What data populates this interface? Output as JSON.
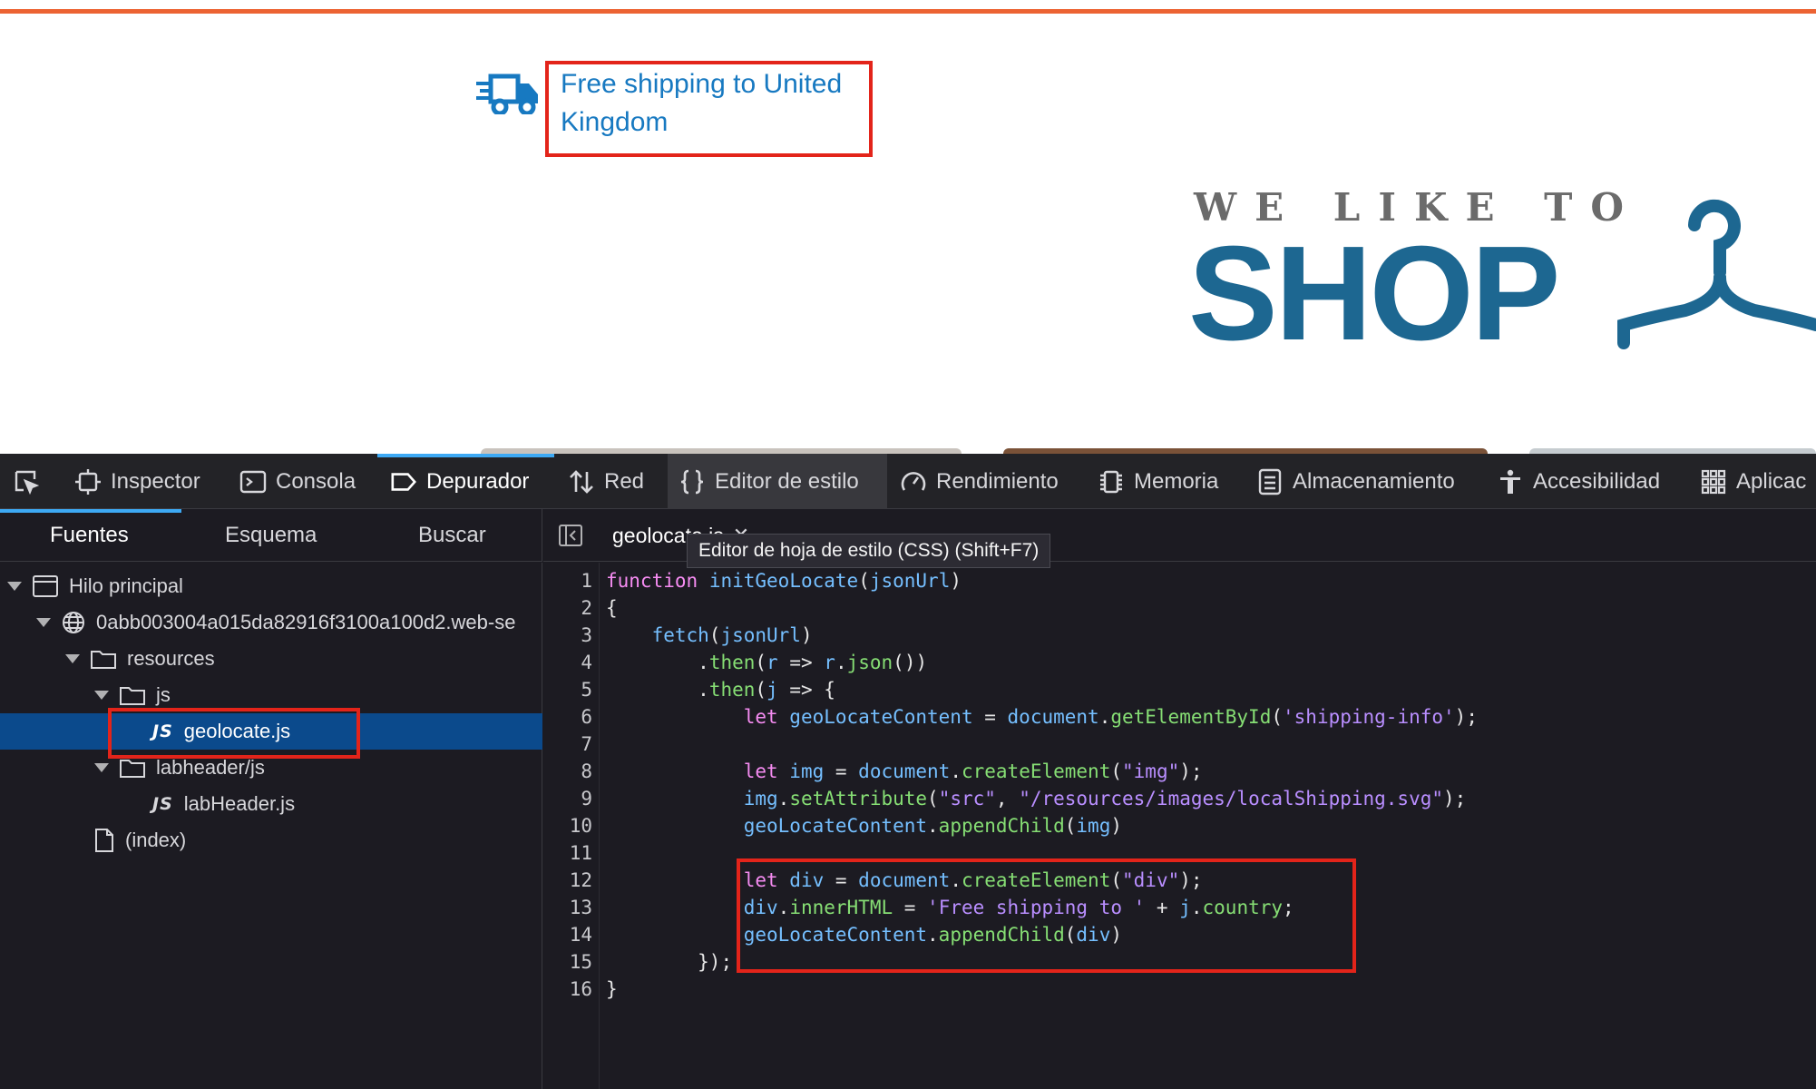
{
  "webpage": {
    "shipping_text": "Free shipping to United Kingdom",
    "tagline": "WE LIKE TO",
    "logo_word": "SHOP",
    "truck_icon": "truck-icon",
    "hanger_icon": "hanger-icon",
    "colors": {
      "accent_bar": "#ec6333",
      "link_blue": "#1779c1",
      "logo_blue": "#1d6791",
      "highlight_red": "#e3241a"
    }
  },
  "devtools": {
    "toolbar": {
      "picker_icon": "element-picker-icon",
      "tabs": [
        {
          "label": "Inspector",
          "icon": "inspector-icon"
        },
        {
          "label": "Consola",
          "icon": "console-icon"
        },
        {
          "label": "Depurador",
          "icon": "debugger-icon",
          "active": true
        },
        {
          "label": "Red",
          "icon": "network-icon"
        },
        {
          "label": "Editor de estilo",
          "icon": "style-editor-icon",
          "hovered": true
        },
        {
          "label": "Rendimiento",
          "icon": "performance-icon"
        },
        {
          "label": "Memoria",
          "icon": "memory-icon"
        },
        {
          "label": "Almacenamiento",
          "icon": "storage-icon"
        },
        {
          "label": "Accesibilidad",
          "icon": "accessibility-icon"
        },
        {
          "label": "Aplicac",
          "icon": "application-icon"
        }
      ]
    },
    "sources_tabs": [
      "Fuentes",
      "Esquema",
      "Buscar"
    ],
    "tree": {
      "main_thread": "Hilo principal",
      "domain": "0abb003004a015da82916f3100a100d2.web-se",
      "resources": "resources",
      "js_folder": "js",
      "geolocate_file": "geolocate.js",
      "labheader_folder": "labheader/js",
      "labheader_file": "labHeader.js",
      "index_file": "(index)",
      "js_badge": "JS"
    },
    "editor": {
      "tab_label": "geolocate.js",
      "tooltip": "Editor de hoja de estilo (CSS) (Shift+F7)",
      "line_numbers": [
        "1",
        "2",
        "3",
        "4",
        "5",
        "6",
        "7",
        "8",
        "9",
        "10",
        "11",
        "12",
        "13",
        "14",
        "15",
        "16"
      ],
      "code": {
        "l1": {
          "kw": "function",
          "name": "initGeoLocate",
          "p1": "(",
          "arg": "jsonUrl",
          "p2": ")"
        },
        "l2": "{",
        "l3": {
          "indent": "    ",
          "call": "fetch",
          "p1": "(",
          "arg": "jsonUrl",
          "p2": ")"
        },
        "l4": {
          "indent": "        ",
          "dot": ".",
          "then": "then",
          "p1": "(",
          "a": "r",
          "arrow": " => ",
          "b": "r",
          "dot2": ".",
          "json": "json",
          "end": "())"
        },
        "l5": {
          "indent": "        ",
          "dot": ".",
          "then": "then",
          "p1": "(",
          "a": "j",
          "arrow": " => ",
          "end": "{"
        },
        "l6": {
          "indent": "            ",
          "kw": "let",
          "name": " geoLocateContent",
          "eq": " = ",
          "obj": "document",
          "dot": ".",
          "method": "getElementById",
          "p1": "(",
          "str": "'shipping-info'",
          "end": ");"
        },
        "l8": {
          "indent": "            ",
          "kw": "let",
          "name": " img",
          "eq": " = ",
          "obj": "document",
          "dot": ".",
          "method": "createElement",
          "p1": "(",
          "str": "\"img\"",
          "end": ");"
        },
        "l9": {
          "indent": "            ",
          "obj": "img",
          "dot": ".",
          "method": "setAttribute",
          "p1": "(",
          "str1": "\"src\"",
          "comma": ", ",
          "str2": "\"/resources/images/localShipping.svg\"",
          "end": ");"
        },
        "l10": {
          "indent": "            ",
          "obj": "geoLocateContent",
          "dot": ".",
          "method": "appendChild",
          "p1": "(",
          "arg": "img",
          "end": ")"
        },
        "l12": {
          "indent": "            ",
          "kw": "let",
          "name": " div",
          "eq": " = ",
          "obj": "document",
          "dot": ".",
          "method": "createElement",
          "p1": "(",
          "str": "\"div\"",
          "end": ");"
        },
        "l13": {
          "indent": "            ",
          "obj": "div",
          "dot": ".",
          "prop": "innerHTML",
          "eq": " = ",
          "str": "'Free shipping to '",
          "plus": " + ",
          "obj2": "j",
          "dot2": ".",
          "prop2": "country",
          "end": ";"
        },
        "l14": {
          "indent": "            ",
          "obj": "geoLocateContent",
          "dot": ".",
          "method": "appendChild",
          "p1": "(",
          "arg": "div",
          "end": ")"
        },
        "l15": {
          "indent": "        ",
          "end": "});"
        },
        "l16": "}"
      }
    }
  }
}
